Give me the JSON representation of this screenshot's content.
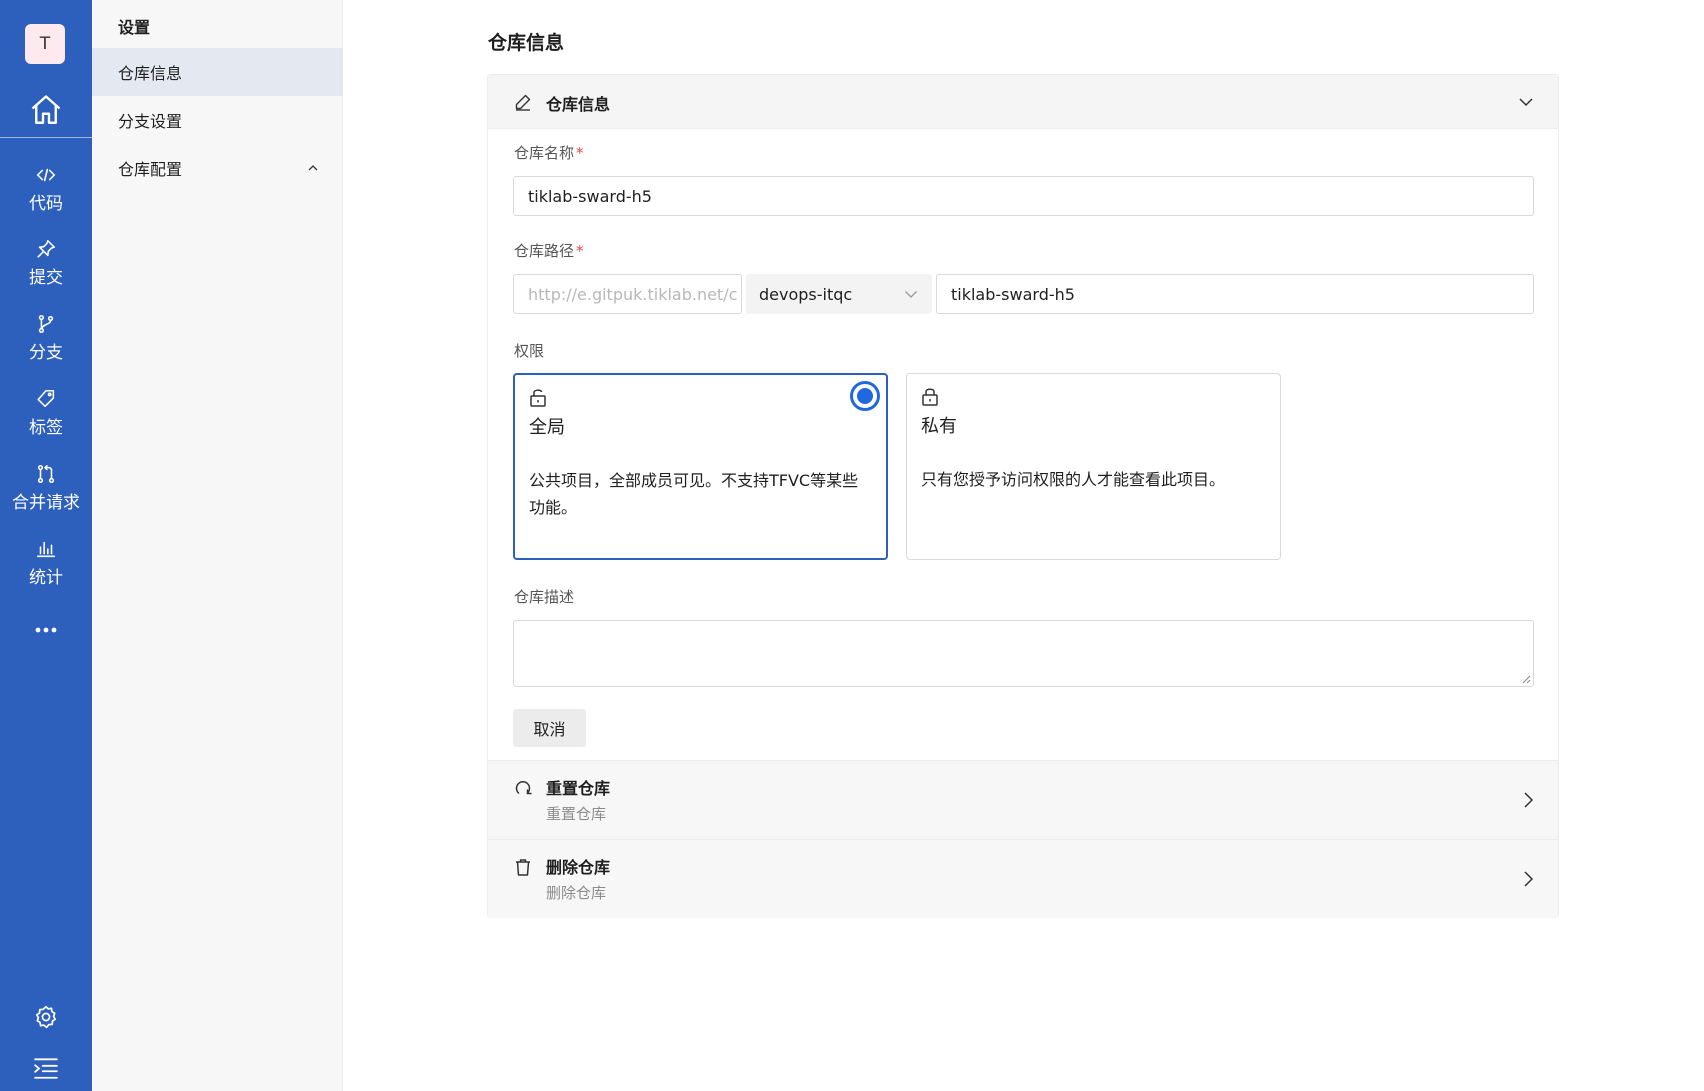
{
  "rail": {
    "avatar": "T",
    "items": [
      {
        "label": "代码",
        "icon": "code-icon"
      },
      {
        "label": "提交",
        "icon": "pin-icon"
      },
      {
        "label": "分支",
        "icon": "branch-icon"
      },
      {
        "label": "标签",
        "icon": "tag-icon"
      },
      {
        "label": "合并请求",
        "icon": "merge-request-icon"
      },
      {
        "label": "统计",
        "icon": "bar-chart-icon"
      }
    ],
    "color": "#2d5fbd"
  },
  "subnav": {
    "title": "设置",
    "items": [
      {
        "label": "仓库信息",
        "active": true
      },
      {
        "label": "分支设置",
        "active": false
      },
      {
        "label": "仓库配置",
        "active": false
      }
    ]
  },
  "page": {
    "title": "仓库信息"
  },
  "section": {
    "header": "仓库信息",
    "name_label": "仓库名称",
    "name_value": "tiklab-sward-h5",
    "path_label": "仓库路径",
    "path_prefix_placeholder": "http://e.gitpuk.tiklab.net/c",
    "path_group": "devops-itqc",
    "path_name": "tiklab-sward-h5",
    "perm_label": "权限",
    "perm_public_title": "全局",
    "perm_public_desc": "公共项目，全部成员可见。不支持TFVC等某些功能。",
    "perm_private_title": "私有",
    "perm_private_desc": "只有您授予访问权限的人才能查看此项目。",
    "perm_selected": "全局",
    "desc_label": "仓库描述",
    "cancel": "取消",
    "required_mark": "*"
  },
  "rows": [
    {
      "title": "重置仓库",
      "subtitle": "重置仓库",
      "icon": "reset-icon"
    },
    {
      "title": "删除仓库",
      "subtitle": "删除仓库",
      "icon": "trash-icon"
    }
  ],
  "colors": {
    "accent": "#1f68e0",
    "required": "#e5484d"
  }
}
